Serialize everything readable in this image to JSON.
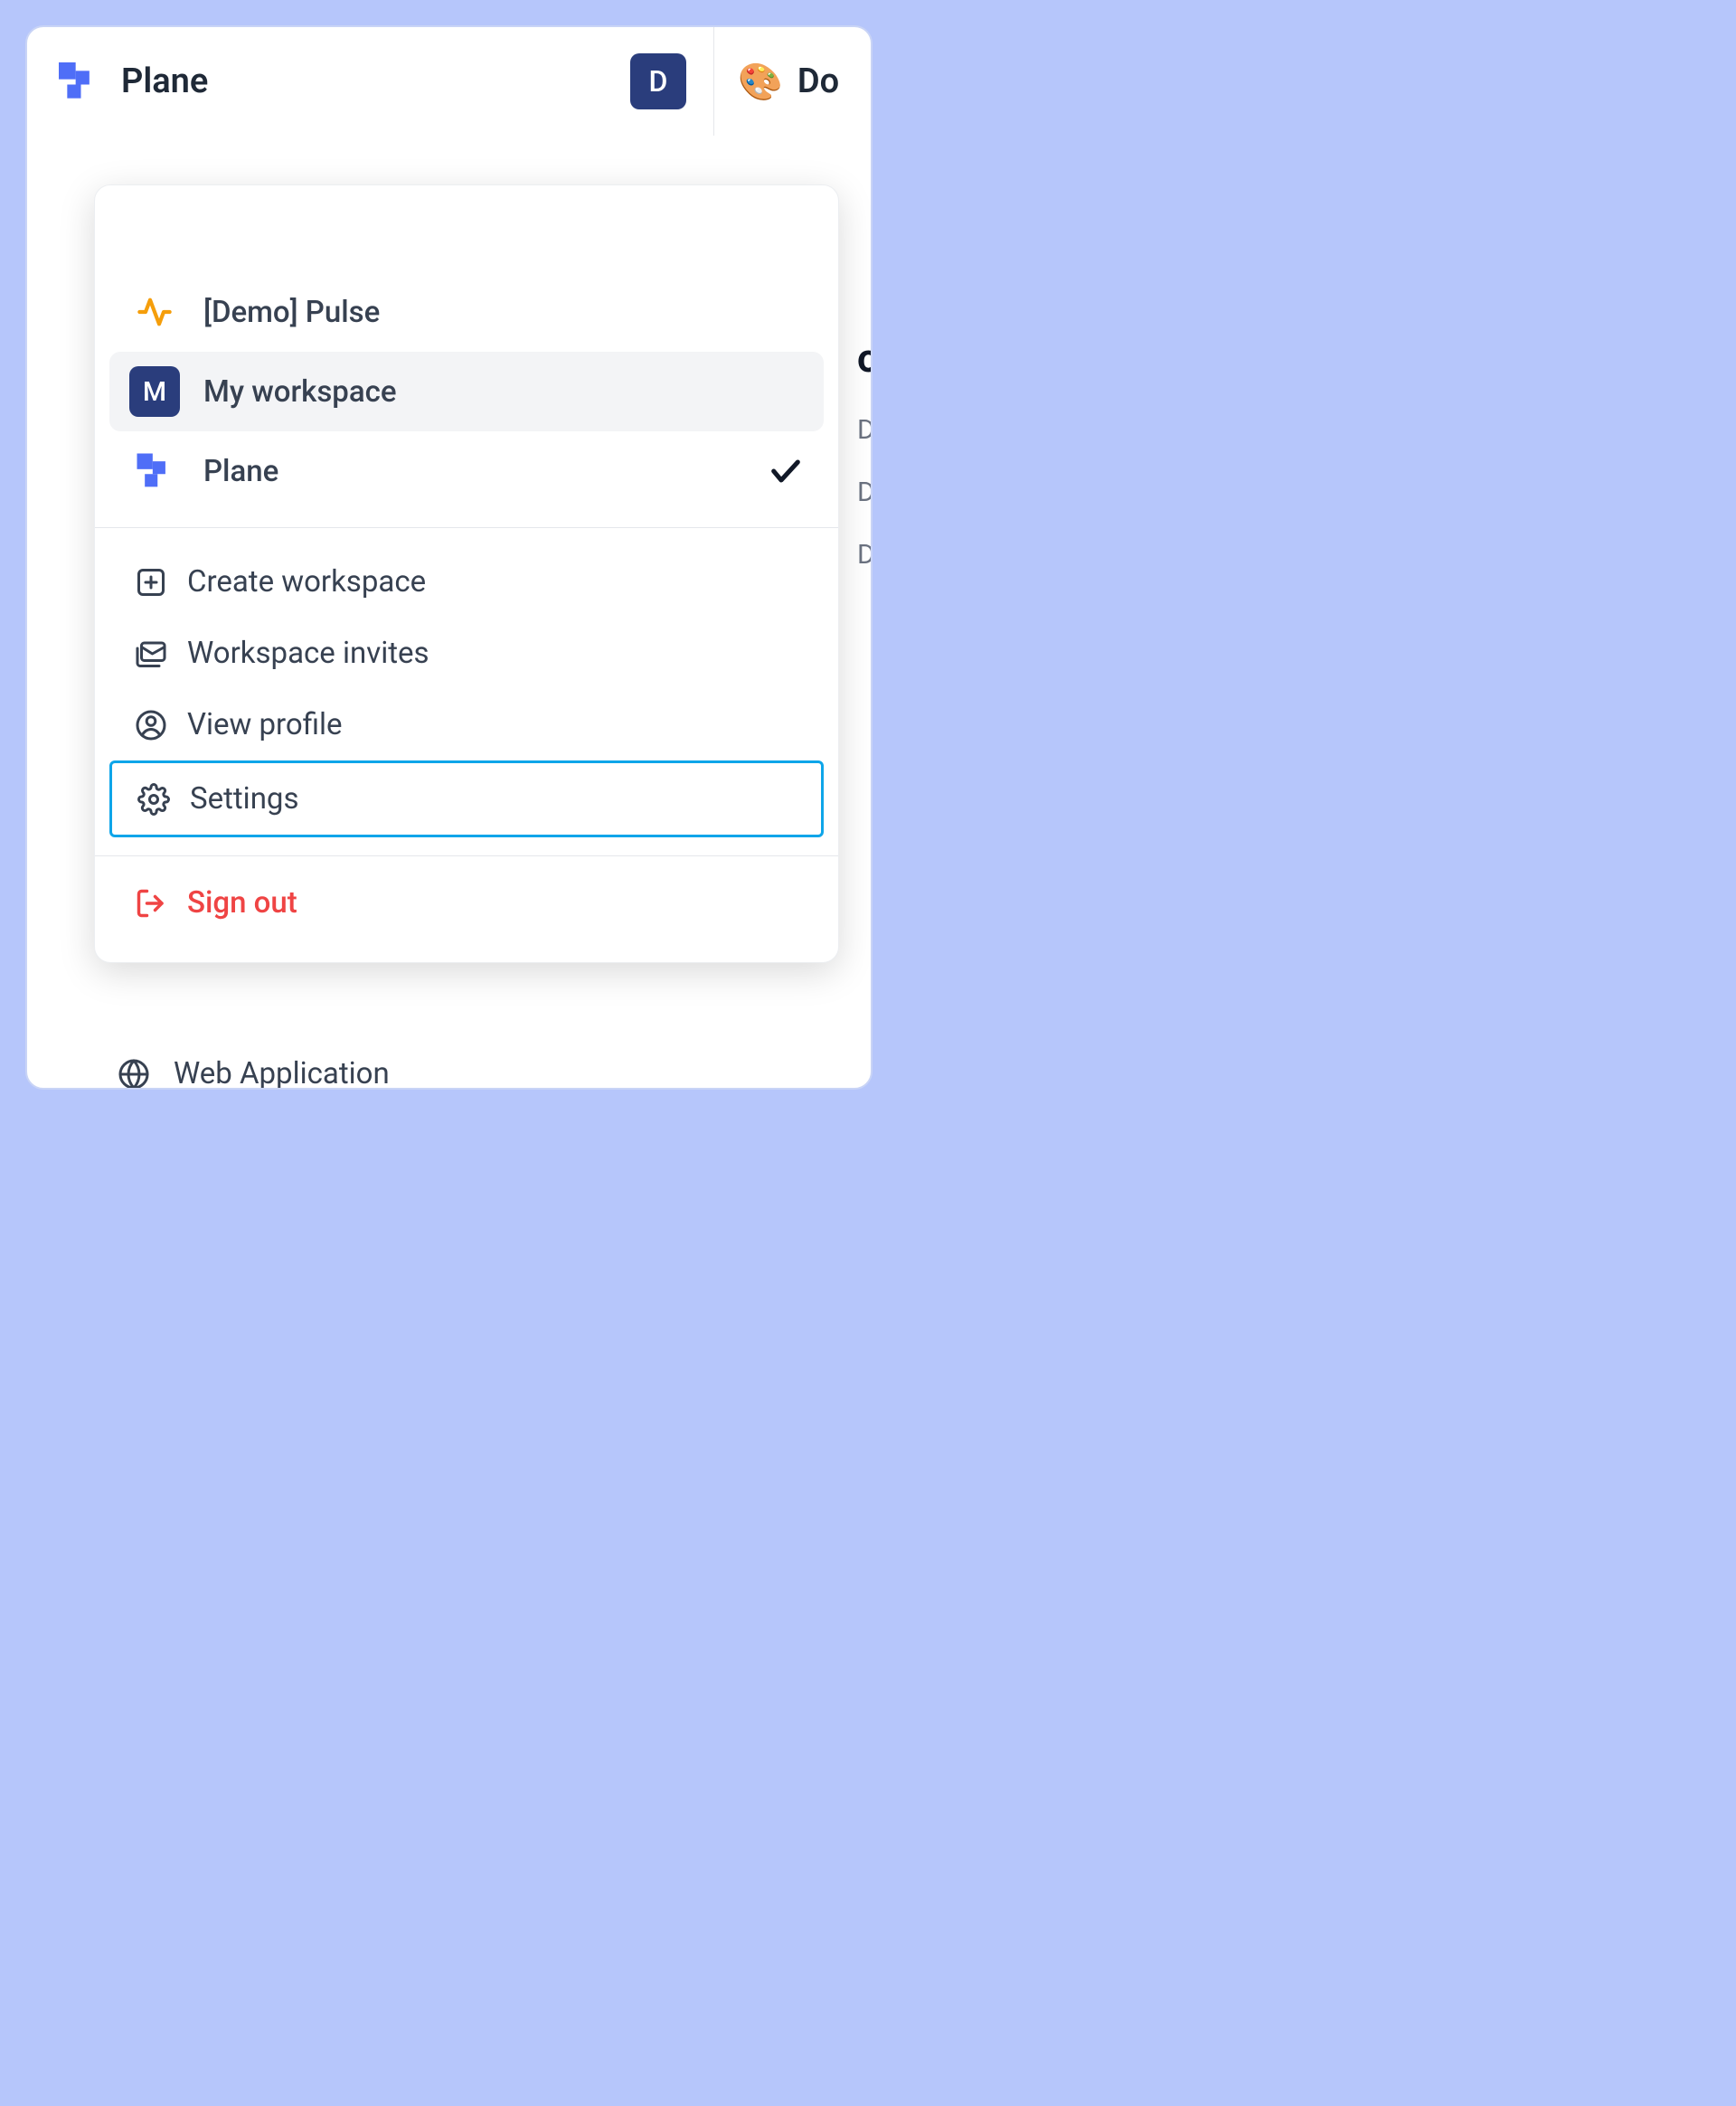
{
  "header": {
    "workspace_title": "Plane",
    "avatar_letter": "D",
    "right_text": "Do"
  },
  "workspaces": [
    {
      "label": "[Demo] Pulse",
      "icon_type": "pulse",
      "selected": false,
      "active": false
    },
    {
      "label": "My workspace",
      "icon_type": "letter",
      "letter": "M",
      "selected": false,
      "active": true
    },
    {
      "label": "Plane",
      "icon_type": "plane",
      "selected": true,
      "active": false
    }
  ],
  "actions": {
    "create_workspace": "Create workspace",
    "workspace_invites": "Workspace invites",
    "view_profile": "View profile",
    "settings": "Settings"
  },
  "signout": "Sign out",
  "background": {
    "title_fragment": "ole",
    "row1": "Dir",
    "row2": "Dir",
    "row3": "Dir"
  },
  "bottom_item": "Web Application"
}
